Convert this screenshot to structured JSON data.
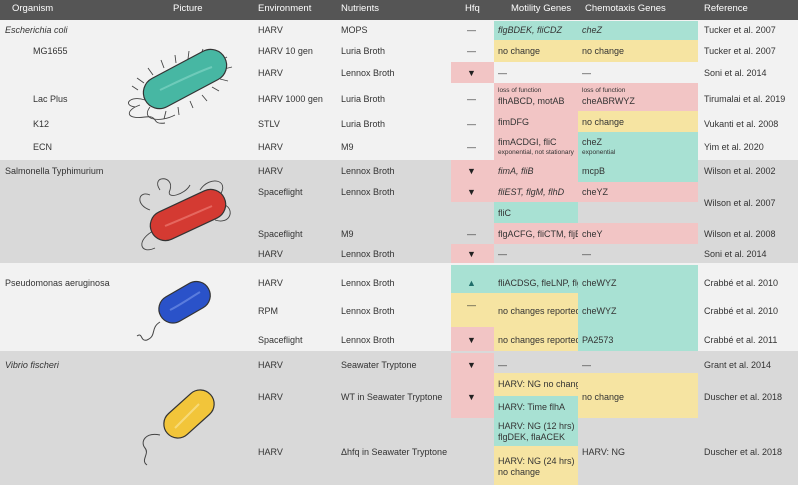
{
  "header": {
    "organism": "Organism",
    "picture": "Picture",
    "environment": "Environment",
    "nutrients": "Nutrients",
    "hfq": "Hfq",
    "motility": "Motility Genes",
    "chemotaxis": "Chemotaxis Genes",
    "reference": "Reference"
  },
  "ecoli": {
    "name": "Escherichia coli",
    "strains": [
      "MG1655",
      "Lac Plus",
      "K12",
      "ECN"
    ],
    "rows": [
      {
        "env": "HARV",
        "nut": "MOPS",
        "hfq": "—",
        "mot": "flgBDEK, fliCDZ",
        "chem": "cheZ",
        "ref": "Tucker et al. 2007"
      },
      {
        "env": "HARV 10 gen",
        "nut": "Luria Broth",
        "hfq": "—",
        "mot": "no change",
        "chem": "no change",
        "ref": "Tucker et al. 2007"
      },
      {
        "env": "HARV",
        "nut": "Lennox Broth",
        "hfq": "▼",
        "mot": "—",
        "chem": "—",
        "ref": "Soni et al. 2014"
      },
      {
        "env": "HARV 1000 gen",
        "nut": "Luria Broth",
        "hfq": "—",
        "mot_note": "loss of function",
        "mot": "flhABCD, motAB",
        "chem_note": "loss of function",
        "chem": "cheABRWYZ",
        "ref": "Tirumalai et al. 2019"
      },
      {
        "env": "STLV",
        "nut": "Luria Broth",
        "hfq": "—",
        "mot": "fimDFG",
        "chem": "no change",
        "ref": "Vukanti et al. 2008"
      },
      {
        "env": "HARV",
        "nut": "M9",
        "hfq": "—",
        "mot": "fimACDGI, fliC",
        "mot_note": "exponential, not stationary",
        "chem": "cheZ",
        "chem_note": "exponential",
        "ref": "Yim et al. 2020"
      }
    ]
  },
  "salmonella": {
    "name": "Salmonella Typhimurium",
    "rows": [
      {
        "env": "HARV",
        "nut": "Lennox Broth",
        "hfq": "▼",
        "mot": "fimA, fliB",
        "chem": "mcpB",
        "ref": "Wilson et al. 2002"
      },
      {
        "env": "Spaceflight",
        "nut": "Lennox Broth",
        "hfq": "▼",
        "mot": "fliEST, flgM, flhD",
        "chem": "cheYZ",
        "ref": "Wilson et al. 2007"
      },
      {
        "mot": "fliC"
      },
      {
        "env": "Spaceflight",
        "nut": "M9",
        "hfq": "—",
        "mot": "flgACFG, fliCTM, fljB",
        "chem": "cheY",
        "ref": "Wilson et al. 2008"
      },
      {
        "env": "HARV",
        "nut": "Lennox Broth",
        "hfq": "▼",
        "mot": "—",
        "chem": "—",
        "ref": "Soni et al. 2014"
      }
    ]
  },
  "pseudomonas": {
    "name": "Pseudomonas aeruginosa",
    "rows": [
      {
        "env": "HARV",
        "nut": "Lennox Broth",
        "hfq": "▲",
        "mot": "fliACDSG, fleLNP, flgM",
        "chem": "cheWYZ",
        "ref": "Crabbé et al. 2010"
      },
      {
        "env": "RPM",
        "nut": "Lennox Broth",
        "hfq": "—",
        "mot": "no changes reported",
        "chem": "cheWYZ",
        "ref": "Crabbé et al. 2010"
      },
      {
        "env": "Spaceflight",
        "nut": "Lennox Broth",
        "hfq": "▼",
        "mot": "no changes reported",
        "chem": "PA2573",
        "ref": "Crabbé et al. 2011"
      }
    ]
  },
  "vibrio": {
    "name": "Vibrio fischeri",
    "rows": [
      {
        "env": "HARV",
        "nut": "Seawater Tryptone",
        "hfq": "▼",
        "mot": "—",
        "chem": "—",
        "ref": "Grant et al. 2014"
      },
      {
        "env": "HARV",
        "nut": "WT in Seawater Tryptone",
        "hfq": "▼",
        "mot": "HARV: NG no change",
        "mot2": "HARV: Time flhA",
        "chem": "no change",
        "ref": "Duscher et al. 2018"
      },
      {
        "env": "HARV",
        "nut": "Δhfq in Seawater Tryptone",
        "hfq": "",
        "mot_a": "HARV: NG (12 hrs)",
        "mot_b": "flgDEK, flaACEK",
        "mot_c": "HARV: NG (24 hrs)",
        "mot_d": "no change",
        "chem": "HARV: NG",
        "ref": "Duscher et al. 2018"
      }
    ]
  },
  "colors": {
    "header": "#555555",
    "band_light": "#f2f2f2",
    "band_dark": "#d9d9d9",
    "green": "#a8e1d3",
    "pink": "#f2c5c5",
    "yellow": "#f6e4a2",
    "ecoli_cell": "#47b7a3",
    "salmonella_cell": "#d43a32",
    "pseudomonas_cell": "#2a52c9",
    "vibrio_cell": "#f2c53a"
  }
}
